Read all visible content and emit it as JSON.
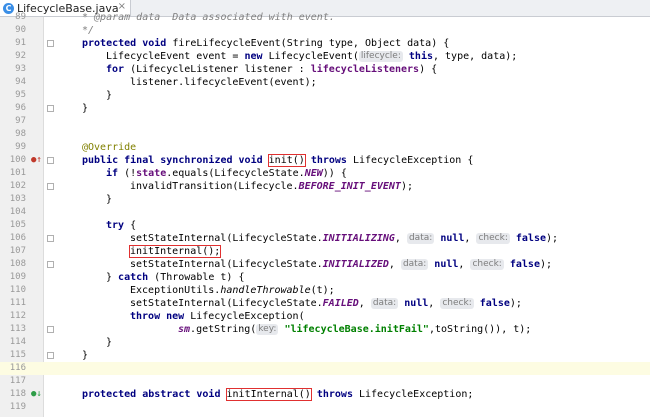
{
  "tab": {
    "file_name": "LifecycleBase.java",
    "icon": "java-class-icon",
    "close_glyph": "×"
  },
  "lines": [
    {
      "n": "89"
    },
    {
      "n": "90"
    },
    {
      "n": "91"
    },
    {
      "n": "92"
    },
    {
      "n": "93"
    },
    {
      "n": "94"
    },
    {
      "n": "95"
    },
    {
      "n": "96"
    },
    {
      "n": "97"
    },
    {
      "n": "98"
    },
    {
      "n": "99"
    },
    {
      "n": "100"
    },
    {
      "n": "101"
    },
    {
      "n": "102"
    },
    {
      "n": "103"
    },
    {
      "n": "104"
    },
    {
      "n": "105"
    },
    {
      "n": "106"
    },
    {
      "n": "107"
    },
    {
      "n": "108"
    },
    {
      "n": "109"
    },
    {
      "n": "110"
    },
    {
      "n": "111"
    },
    {
      "n": "112"
    },
    {
      "n": "113"
    },
    {
      "n": "114"
    },
    {
      "n": "115"
    },
    {
      "n": "116"
    },
    {
      "n": "117"
    },
    {
      "n": "118"
    },
    {
      "n": "119"
    }
  ],
  "code": {
    "l89": "* @param data  Data associated with event.",
    "l90": "*/",
    "l91a": "protected void",
    "l91b": " fireLifecycleEvent(String type, Object data) {",
    "l92a": "LifecycleEvent event = ",
    "l92b": "new",
    "l92c": " LifecycleEvent(",
    "l92hint": "lifecycle:",
    "l92d": "this",
    "l92e": ", type, data);",
    "l93a": "for",
    "l93b": " (LifecycleListener listener : ",
    "l93c": "lifecycleListeners",
    "l93d": ") {",
    "l94": "listener.lifecycleEvent(event);",
    "l95": "}",
    "l96": "}",
    "l99": "@Override",
    "l100a": "public final synchronized void",
    "l100b": "init()",
    "l100c": "throws",
    "l100d": " LifecycleException {",
    "l101a": "if",
    "l101b": " (!",
    "l101c": "state",
    "l101d": ".equals(LifecycleState.",
    "l101e": "NEW",
    "l101f": ")) {",
    "l102a": "invalidTransition(Lifecycle.",
    "l102b": "BEFORE_INIT_EVENT",
    "l102c": ");",
    "l103": "}",
    "l105a": "try",
    "l105b": " {",
    "l106a": "setStateInternal(LifecycleState.",
    "l106b": "INITIALIZING",
    "l106c": ",",
    "l106hint1": "data:",
    "l106d": "null",
    "l106e": ",",
    "l106hint2": "check:",
    "l106f": "false",
    "l106g": ");",
    "l107": "initInternal();",
    "l108a": "setStateInternal(LifecycleState.",
    "l108b": "INITIALIZED",
    "l108c": ",",
    "l108hint1": "data:",
    "l108d": "null",
    "l108e": ",",
    "l108hint2": "check:",
    "l108f": "false",
    "l108g": ");",
    "l109a": "} ",
    "l109b": "catch",
    "l109c": " (Throwable t) {",
    "l110a": "ExceptionUtils.",
    "l110b": "handleThrowable",
    "l110c": "(t);",
    "l111a": "setStateInternal(LifecycleState.",
    "l111b": "FAILED",
    "l111c": ",",
    "l111hint1": "data:",
    "l111d": "null",
    "l111e": ",",
    "l111hint2": "check:",
    "l111f": "false",
    "l111g": ");",
    "l112a": "throw new",
    "l112b": " LifecycleException(",
    "l113a": "sm",
    "l113b": ".getString(",
    "l113hint": "key:",
    "l113c": "\"lifecycleBase.initFail\"",
    "l113d": ",toString()), t);",
    "l114": "}",
    "l115": "}",
    "l118a": "protected abstract void",
    "l118b": "initInternal()",
    "l118c": "throws",
    "l118d": " LifecycleException;"
  },
  "gutter_icons": {
    "l100": "override-marker-icon",
    "l118": "implemented-marker-icon"
  },
  "colors": {
    "keyword": "#000080",
    "field": "#660e7a",
    "string": "#008000",
    "annotation": "#808000",
    "highlight_box": "#e03030",
    "current_line": "#fdfce2"
  }
}
